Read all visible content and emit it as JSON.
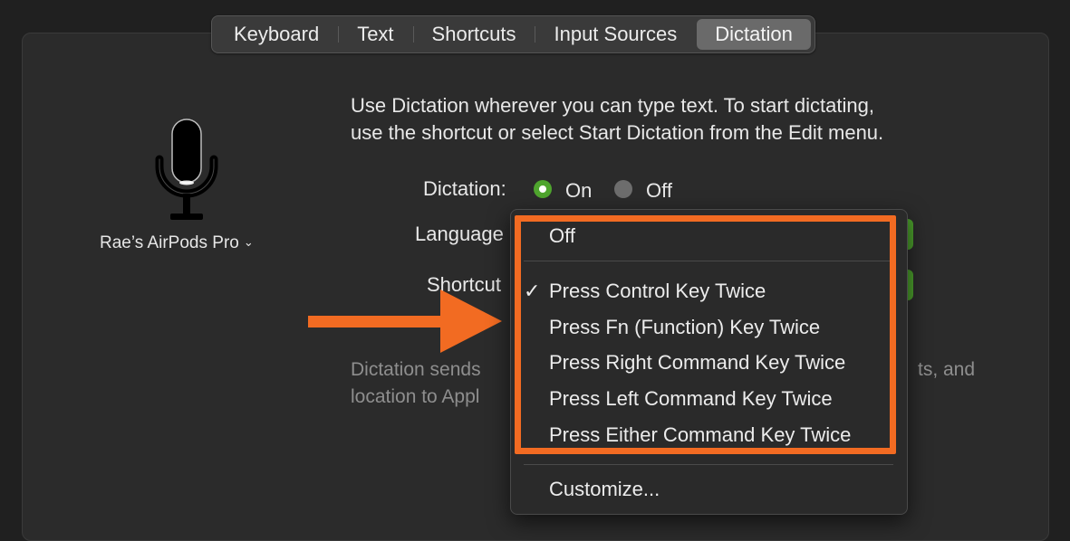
{
  "tabs": [
    {
      "label": "Keyboard"
    },
    {
      "label": "Text"
    },
    {
      "label": "Shortcuts"
    },
    {
      "label": "Input Sources"
    },
    {
      "label": "Dictation",
      "active": true
    }
  ],
  "device": {
    "label": "Rae’s AirPods Pro",
    "chevron": "chevron-down-icon"
  },
  "description": {
    "line1": "Use Dictation wherever you can type text. To start dictating,",
    "line2": "use the shortcut or select Start Dictation from the Edit menu."
  },
  "dictation": {
    "label": "Dictation:",
    "on_label": "On",
    "off_label": "Off",
    "selected": "On"
  },
  "language": {
    "label": "Language"
  },
  "shortcut": {
    "label": "Shortcut"
  },
  "footer": {
    "line1_visible": "Dictation sends",
    "line1_tail": "ts, and",
    "line2_visible": "location to Appl"
  },
  "shortcut_menu": {
    "items": [
      {
        "label": "Off"
      },
      {
        "label": "Press Control Key Twice",
        "checked": true
      },
      {
        "label": "Press Fn (Function) Key Twice"
      },
      {
        "label": "Press Right Command Key Twice"
      },
      {
        "label": "Press Left Command Key Twice"
      },
      {
        "label": "Press Either Command Key Twice"
      },
      {
        "label": "Customize..."
      }
    ],
    "check_glyph": "✓"
  },
  "colors": {
    "accent_green": "#4fa52e",
    "highlight_orange": "#f26b22",
    "background": "#202020"
  }
}
